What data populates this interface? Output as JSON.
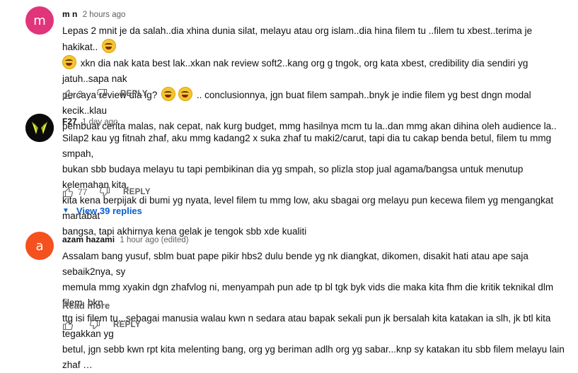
{
  "comments": [
    {
      "avatar_letter": "m",
      "avatar_color": "#e0357a",
      "author": "m n",
      "time": "2 hours ago",
      "lines": [
        "Lepas 2 mnit je  da salah..dia xhina dunia silat, melayu atau org islam..dia hina filem tu ..filem tu xbest..terima je hakikat..",
        "xkn dia nak kata best lak..xkan nak review soft2..kang org g tngok, org kata xbest, credibility dia sendiri yg jatuh..sapa nak",
        "percaya review dia lg?",
        ".. conclusionnya, jgn buat filem sampah..bnyk je indie filem yg best dngn modal kecik..klau",
        "pembuat cerita malas, nak cepat, nak kurg budget, mmg hasilnya mcm tu la..dan mmg akan dihina oleh audience la.."
      ],
      "emoji": "rolling-on-floor-laughing",
      "likes": "3",
      "reply_label": "REPLY"
    },
    {
      "author": "F27",
      "time": "1 day ago",
      "lines": [
        "Silap2 kau yg fitnah zhaf, aku mmg kadang2 x suka zhaf tu maki2/carut, tapi dia tu cakap benda betul, filem tu mmg smpah,",
        "bukan sbb budaya melayu tu tapi pembikinan dia yg smpah, so plizla stop jual agama/bangsa untuk menutup kelemahan kita,",
        "kita kena berpijak di bumi yg nyata, level filem tu mmg low, aku sbagai org melayu pun kecewa filem yg mengangkat martabat",
        "bangsa, tapi akhirnya kena gelak je tengok sbb xde kualiti"
      ],
      "likes": "77",
      "reply_label": "REPLY",
      "view_replies": "View 39 replies"
    },
    {
      "avatar_letter": "a",
      "avatar_color": "#f4511e",
      "author": "azam hazami",
      "time": "1 hour ago (edited)",
      "lines": [
        "Assalam bang yusuf, sblm buat pape pikir hbs2 dulu bende yg nk diangkat, dikomen, disakit hati atau ape saja sebaik2nya, sy",
        "memula mmg xyakin dgn zhafvlog ni, menyampah pun ade tp bl tgk byk vids die maka kita fhm die kritik teknikal dlm filem, bkn",
        "ttg isi filem tu...sebagai manusia walau kwn n sedara atau bapak sekali pun jk bersalah kita katakan ia slh, jk btl kita tegakkan yg",
        "betul, jgn sebb kwn rpt kita melenting bang, org yg beriman adlh org yg sabar...knp sy katakan itu sbb filem melayu lain zhaf     …"
      ],
      "read_more": "Read more",
      "likes": "",
      "reply_label": "REPLY"
    }
  ]
}
